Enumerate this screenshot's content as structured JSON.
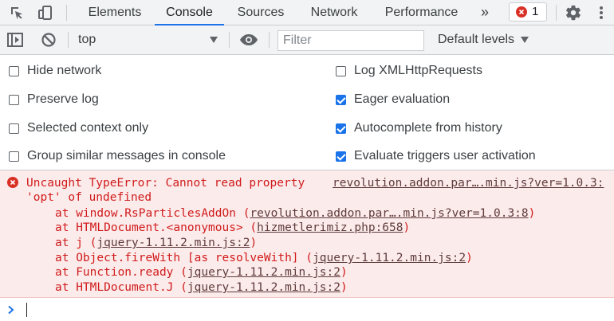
{
  "tabs": [
    {
      "label": "Elements",
      "active": false
    },
    {
      "label": "Console",
      "active": true
    },
    {
      "label": "Sources",
      "active": false
    },
    {
      "label": "Network",
      "active": false
    },
    {
      "label": "Performance",
      "active": false
    }
  ],
  "more_tabs_label": "»",
  "error_count": "1",
  "icons": {
    "inspect": "inspect-element-icon",
    "device": "device-toolbar-icon",
    "settings": "gear-icon",
    "menu": "kebab-menu-icon",
    "sidebar": "sidebar-toggle-icon",
    "clear": "clear-console-icon",
    "eye": "live-expression-icon"
  },
  "toolbar": {
    "context": "top",
    "filter_placeholder": "Filter",
    "levels": "Default levels"
  },
  "settings": {
    "left": [
      {
        "label": "Hide network",
        "checked": false
      },
      {
        "label": "Preserve log",
        "checked": false
      },
      {
        "label": "Selected context only",
        "checked": false
      },
      {
        "label": "Group similar messages in console",
        "checked": false
      }
    ],
    "right": [
      {
        "label": "Log XMLHttpRequests",
        "checked": false
      },
      {
        "label": "Eager evaluation",
        "checked": true
      },
      {
        "label": "Autocomplete from history",
        "checked": true
      },
      {
        "label": "Evaluate triggers user activation",
        "checked": true
      }
    ]
  },
  "error": {
    "message_line1": "Uncaught TypeError: Cannot read property",
    "message_line2": "'opt' of undefined",
    "source": "revolution.addon.par….min.js?ver=1.0.3:",
    "stack": [
      {
        "prefix": "at window.RsParticlesAddOn (",
        "link": "revolution.addon.par….min.js?ver=1.0.3:8",
        "suffix": ")"
      },
      {
        "prefix": "at HTMLDocument.<anonymous> (",
        "link": "hizmetlerimiz.php:658",
        "suffix": ")"
      },
      {
        "prefix": "at j (",
        "link": "jquery-1.11.2.min.js:2",
        "suffix": ")"
      },
      {
        "prefix": "at Object.fireWith [as resolveWith] (",
        "link": "jquery-1.11.2.min.js:2",
        "suffix": ")"
      },
      {
        "prefix": "at Function.ready (",
        "link": "jquery-1.11.2.min.js:2",
        "suffix": ")"
      },
      {
        "prefix": "at HTMLDocument.J (",
        "link": "jquery-1.11.2.min.js:2",
        "suffix": ")"
      }
    ]
  },
  "colors": {
    "accent": "#1a73e8",
    "error": "#d93025",
    "error_bg": "#fcebeb"
  }
}
